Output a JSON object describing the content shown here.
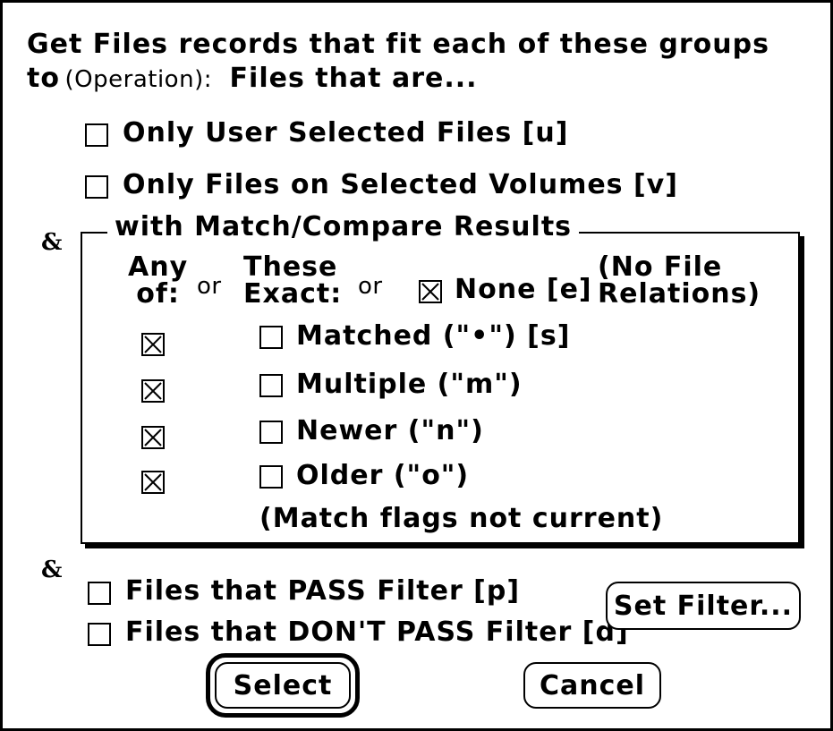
{
  "dialog": {
    "line1": "Get Files records that fit each of these groups",
    "line2_to": "to",
    "line2_operation": "(Operation):",
    "line2_rest": "Files that are..."
  },
  "options": {
    "user_selected": "Only User Selected Files  [u]",
    "selected_volumes": "Only Files on Selected Volumes [v]"
  },
  "ampersand": "&",
  "match_group": {
    "title": "with Match/Compare Results",
    "any_of_1": "Any",
    "any_of_2": "of:",
    "or": "or",
    "these_exact_1": "These",
    "these_exact_2": "Exact:",
    "none_label": "None [e]",
    "no_file_1": "(No File",
    "no_file_2": "Relations)",
    "rows": [
      {
        "label": "Matched  (\"•\") [s]",
        "any_checked": true,
        "exact_checked": false
      },
      {
        "label": "Multiple (\"m\")",
        "any_checked": true,
        "exact_checked": false
      },
      {
        "label": "Newer (\"n\")",
        "any_checked": true,
        "exact_checked": false
      },
      {
        "label": "Older (\"o\")",
        "any_checked": true,
        "exact_checked": false
      }
    ],
    "note": "(Match flags not current)",
    "none_checked": true
  },
  "filter": {
    "pass": "Files that PASS Filter [p]",
    "dont_pass": "Files that DON'T PASS Filter [d]",
    "set_filter": "Set Filter..."
  },
  "buttons": {
    "select": "Select",
    "cancel": "Cancel"
  }
}
